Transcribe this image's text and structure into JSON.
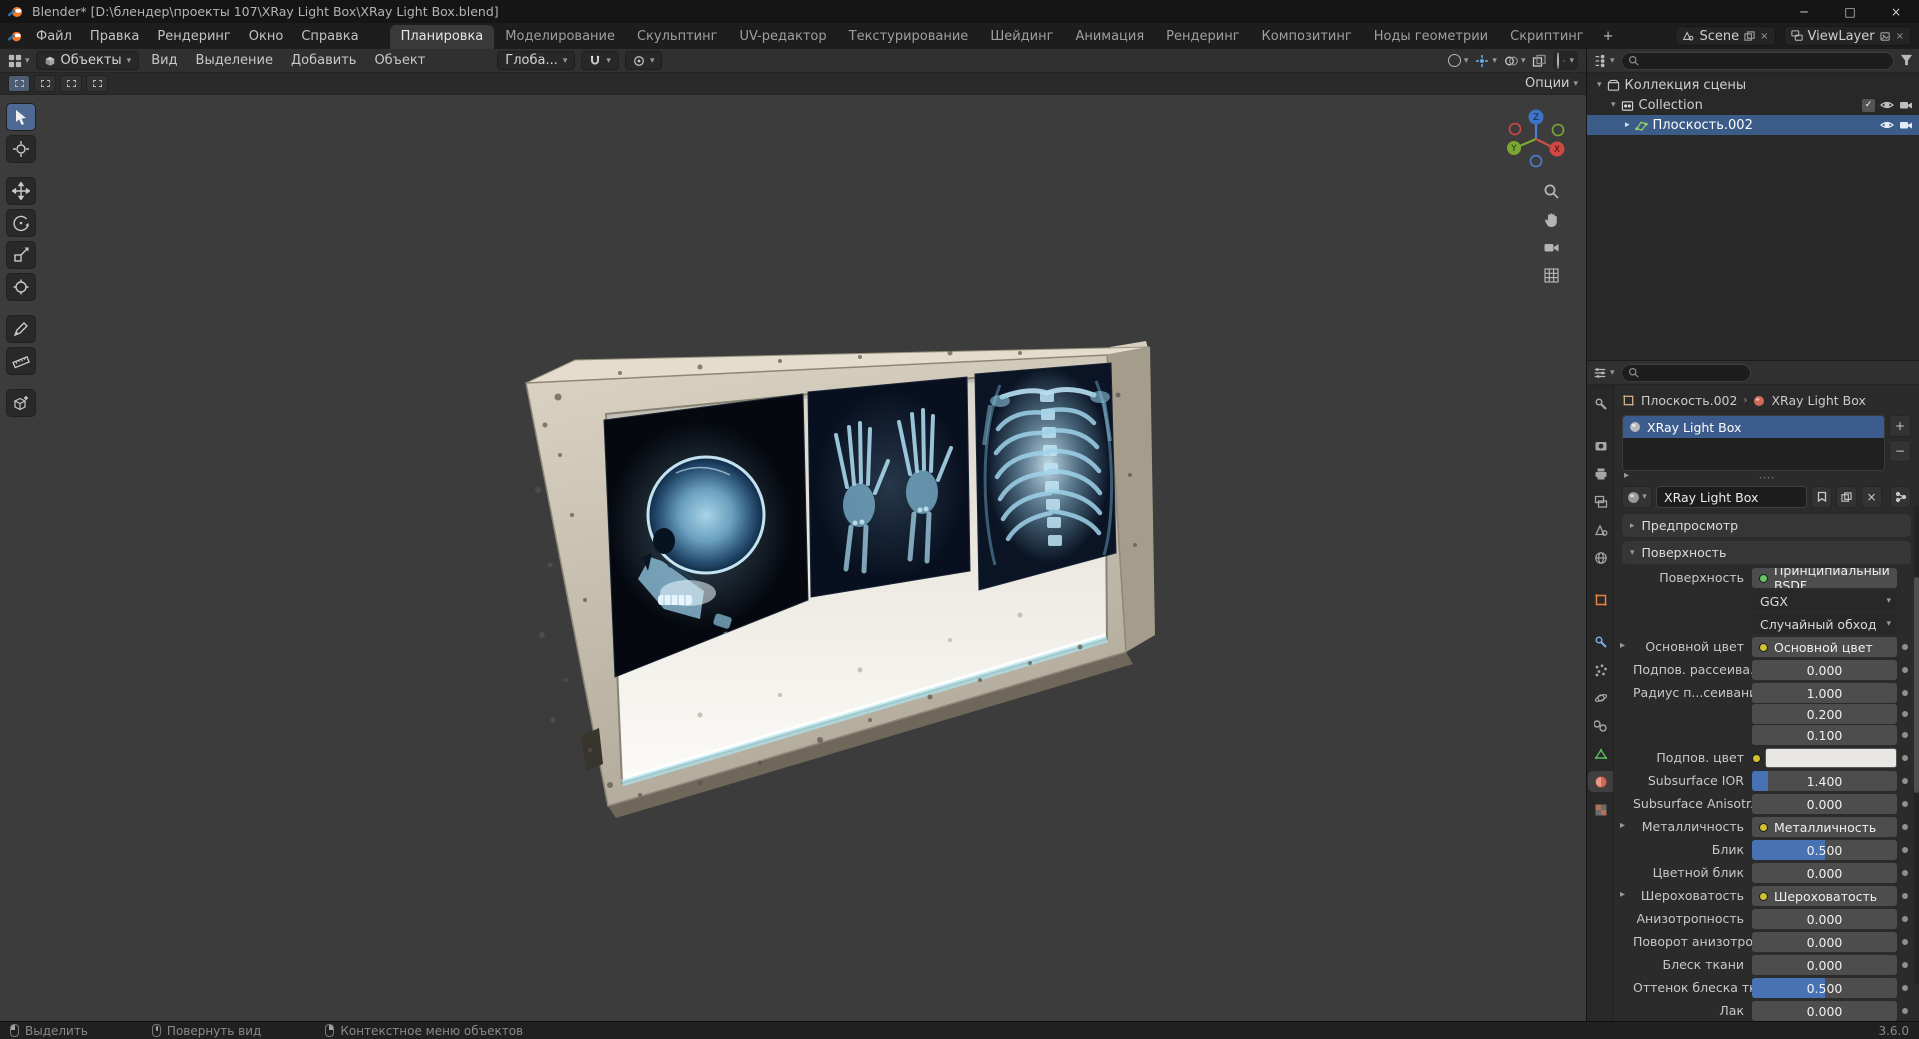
{
  "window": {
    "title": "Blender* [D:\\блендер\\проекты 107\\XRay Light Box\\XRay Light Box.blend]"
  },
  "icons": {
    "chevron_down": "▾",
    "chevron_right": "▸",
    "close": "×",
    "minimize": "─",
    "maximize": "□",
    "plus": "+",
    "minus": "−",
    "check": "✓",
    "sep": "›",
    "dots": "····"
  },
  "menu_bar": {
    "menus": [
      "Файл",
      "Правка",
      "Рендеринг",
      "Окно",
      "Справка"
    ],
    "tabs": [
      "Планировка",
      "Моделирование",
      "Скульптинг",
      "UV-редактор",
      "Текстур​ирование",
      "Шейдинг",
      "Анимация",
      "Рендеринг",
      "Композитинг",
      "Ноды геометрии",
      "Скриптинг"
    ],
    "active_tab": "Планировка",
    "add_tab": "+",
    "scene": "Scene",
    "view_layer": "ViewLayer"
  },
  "viewport": {
    "mode": "Объекты",
    "menus": [
      "Вид",
      "Выделение",
      "Добавить",
      "Объект"
    ],
    "orientation": "Глоба...",
    "options": "Опции",
    "gizmo": {
      "x": "X",
      "y": "Y",
      "z": "Z"
    }
  },
  "outliner": {
    "rows": [
      "Коллекция сцены",
      "Collection",
      "Плоскость.002"
    ]
  },
  "properties": {
    "breadcrumb": {
      "object": "Плоскость.002",
      "material": "XRay Light Box"
    },
    "slot": "XRay Light Box",
    "name": "XRay Light Box",
    "panels": {
      "preview": "Предпросмотр",
      "surface": "Поверхность"
    },
    "surface_rows": [
      {
        "label": "Поверхность",
        "value": "Принципиальный BSDF"
      },
      {
        "label": "",
        "value": "GGX"
      },
      {
        "label": "",
        "value": "Случайный обход"
      },
      {
        "label": "Основной цвет",
        "value": "Основной цвет"
      },
      {
        "label": "Подпов. рассеива...",
        "value": "0.000"
      },
      {
        "label": "Радиус п...сеивания",
        "values": [
          "1.000",
          "0.200",
          "0.100"
        ]
      },
      {
        "label": "Подпов. цвет",
        "value": ""
      },
      {
        "label": "Subsurface IOR",
        "value": "1.400"
      },
      {
        "label": "Subsurface Anisotr...",
        "value": "0.000"
      },
      {
        "label": "Металличность",
        "value": "Металличность"
      },
      {
        "label": "Блик",
        "value": "0.500"
      },
      {
        "label": "Цветной блик",
        "value": "0.000"
      },
      {
        "label": "Шероховатость",
        "value": "Шероховатость"
      },
      {
        "label": "Анизотропность",
        "value": "0.000"
      },
      {
        "label": "Поворот анизотро...",
        "value": "0.000"
      },
      {
        "label": "Блеск ткани",
        "value": "0.000"
      },
      {
        "label": "Оттенок блеска тк...",
        "value": "0.500"
      },
      {
        "label": "Лак",
        "value": "0.000"
      }
    ]
  },
  "status_bar": {
    "items": [
      "Выделить",
      "Повернуть вид",
      "Контекстное меню объектов"
    ],
    "version": "3.6.0"
  }
}
